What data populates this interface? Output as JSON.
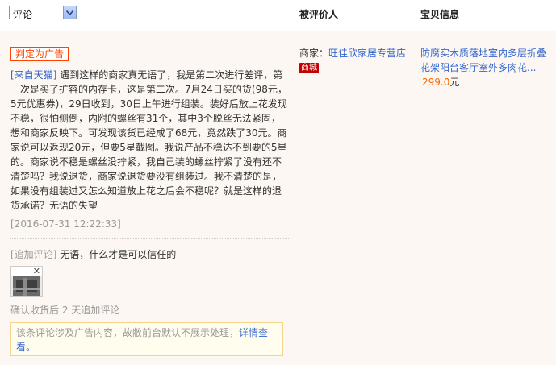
{
  "header": {
    "filter_value": "评论",
    "col_reviewer": "被评价人",
    "col_item": "宝贝信息"
  },
  "review": {
    "ad_badge": "判定为广告",
    "source_tag": "[来自天猫]",
    "body": "遇到这样的商家真无语了，我是第二次进行差评，第一次是买了扩容的内存卡，这是第二次。7月24日买的货(98元，5元优惠券)，29日收到，30日上午进行组装。装好后放上花发现不稳，很怕侧倒，内附的螺丝有31个，其中3个脱丝无法紧固，想和商家反映下。可发现该货已经成了68元，竟然跌了30元。商家说可以返现20元，但要5星截图。我说产品不稳达不到要的5星的。商家说不稳是螺丝没拧紧，我自己装的螺丝拧紧了没有还不清楚吗？我说退货，商家说退货要没有组装过。我不清楚的是，如果没有组装过又怎么知道放上花之后会不稳呢？就是这样的退货承诺？无语的失望",
    "timestamp": "[2016-07-31 12:22:33]",
    "append_tag": "[追加评论]",
    "append_text": "无语，什么才是可以信任的",
    "append_days": "确认收货后 2 天追加评论",
    "notice_text": "该条评论涉及广告内容，故敝前台默认不展示处理，",
    "notice_link": "详情查看。"
  },
  "seller": {
    "label": "商家：",
    "name": "旺佳欣家居专营店",
    "badge": "商城"
  },
  "item": {
    "title": "防腐实木质落地室内多层折叠花架阳台客厅室外多肉花...",
    "price": "299.0",
    "unit": "元"
  },
  "colors": {
    "link": "#3366cc",
    "ad": "#ff4400",
    "price": "#ff6600",
    "row_bg": "#fcf7f2"
  }
}
